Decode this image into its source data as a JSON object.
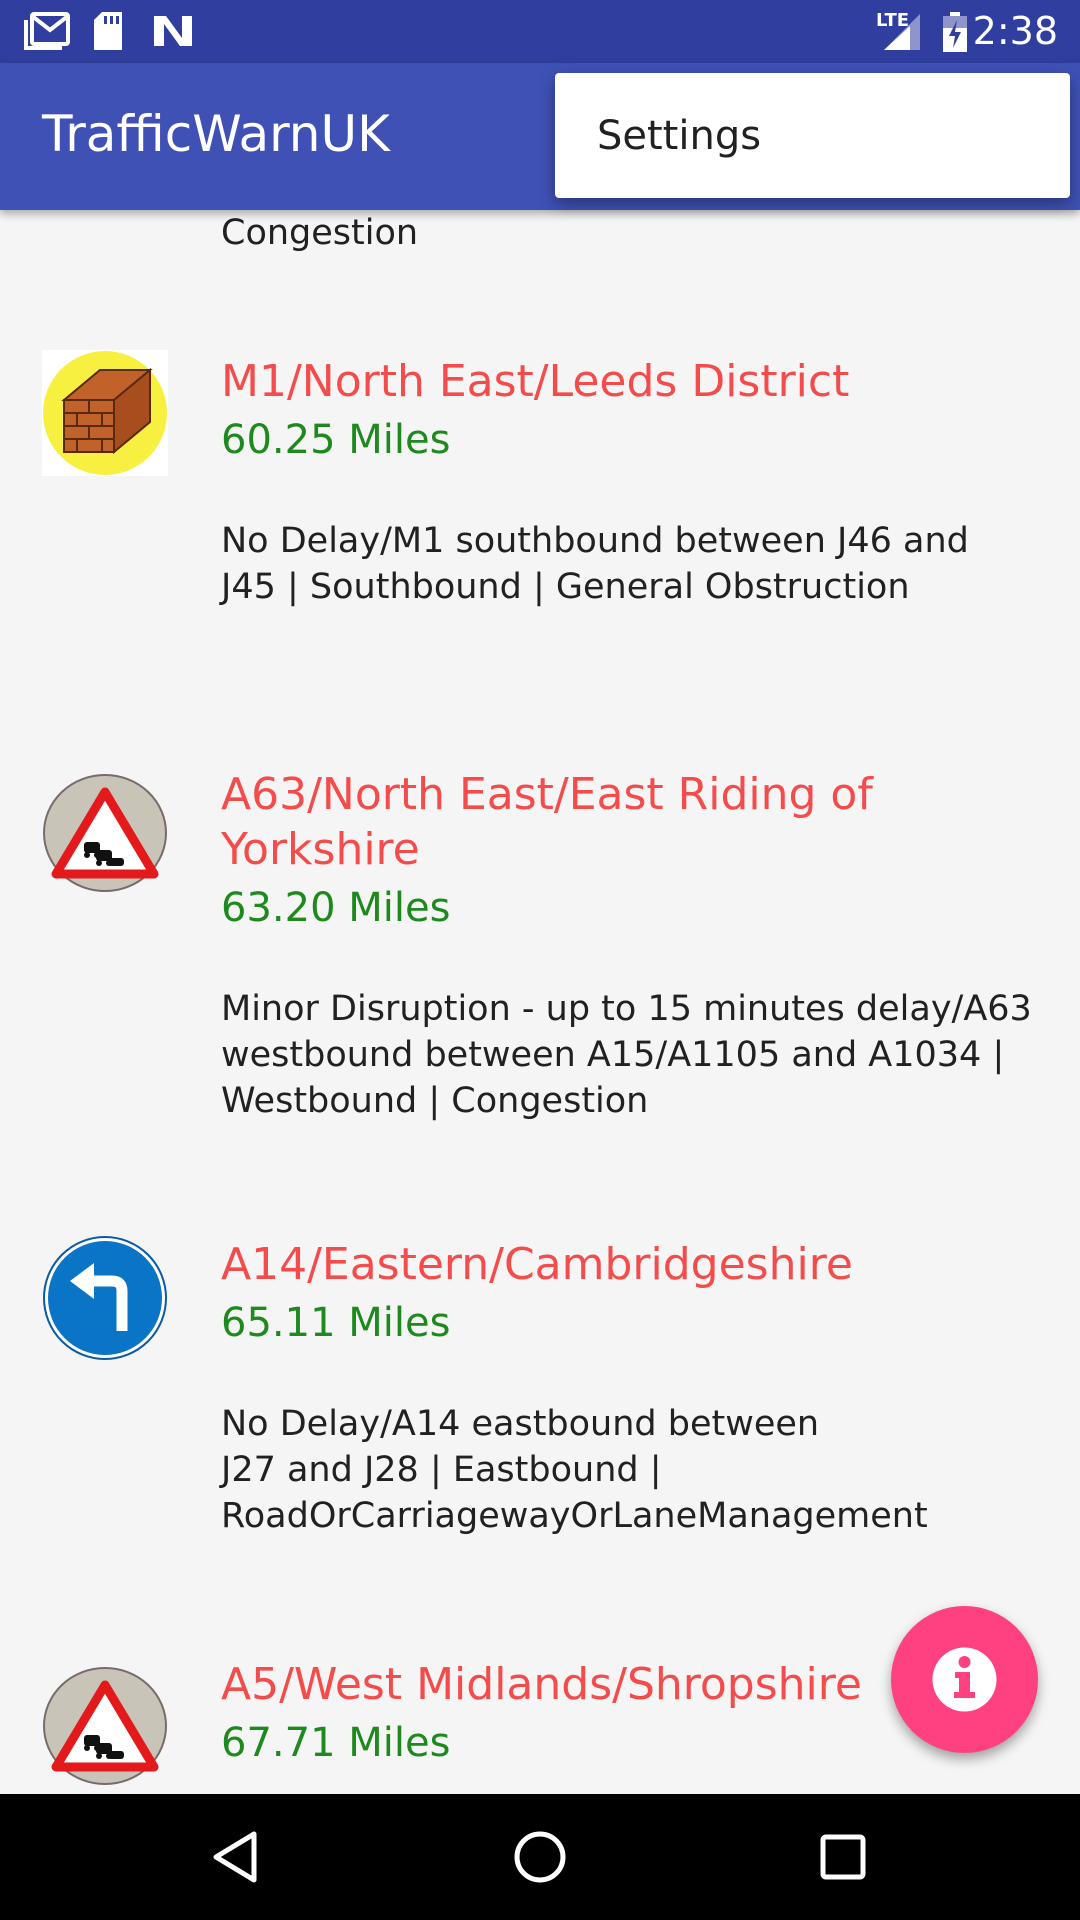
{
  "status_bar": {
    "time": "2:38",
    "network": "LTE"
  },
  "app_bar": {
    "title": "TrafficWarnUK"
  },
  "overflow_menu": {
    "items": [
      {
        "label": "Settings"
      }
    ]
  },
  "list": {
    "partial_top_text": "Congestion",
    "items": [
      {
        "icon": "roadworks-wall-icon",
        "title": "M1/North East/Leeds District",
        "distance": "60.25 Miles",
        "description_lines": [
          "No Delay/M1 southbound between J46 and",
          "J45 | Southbound | General Obstruction"
        ]
      },
      {
        "icon": "queue-warning-sign-icon",
        "title_lines": [
          "A63/North East/East Riding of",
          "Yorkshire"
        ],
        "distance": "63.20 Miles",
        "description_lines": [
          "Minor Disruption - up to 15 minutes delay/A63",
          "westbound between A15/A1105 and A1034 |",
          "Westbound | Congestion"
        ]
      },
      {
        "icon": "turn-left-sign-icon",
        "title": "A14/Eastern/Cambridgeshire",
        "distance": "65.11 Miles",
        "description_lines": [
          "No Delay/A14 eastbound between",
          "J27 and J28 | Eastbound |",
          "RoadOrCarriagewayOrLaneManagement"
        ]
      },
      {
        "icon": "queue-warning-sign-icon",
        "title": "A5/West Midlands/Shropshire",
        "distance": "67.71 Miles"
      }
    ]
  },
  "fab": {
    "icon": "info-icon",
    "color": "#ff4081"
  },
  "colors": {
    "app_bar": "#3f51b5",
    "status_bar": "#303f9f",
    "title_text": "#f44b4b",
    "distance_text": "#1e8a1e"
  },
  "nav_bar": {
    "buttons": [
      "back-icon",
      "home-icon",
      "recents-icon"
    ]
  }
}
